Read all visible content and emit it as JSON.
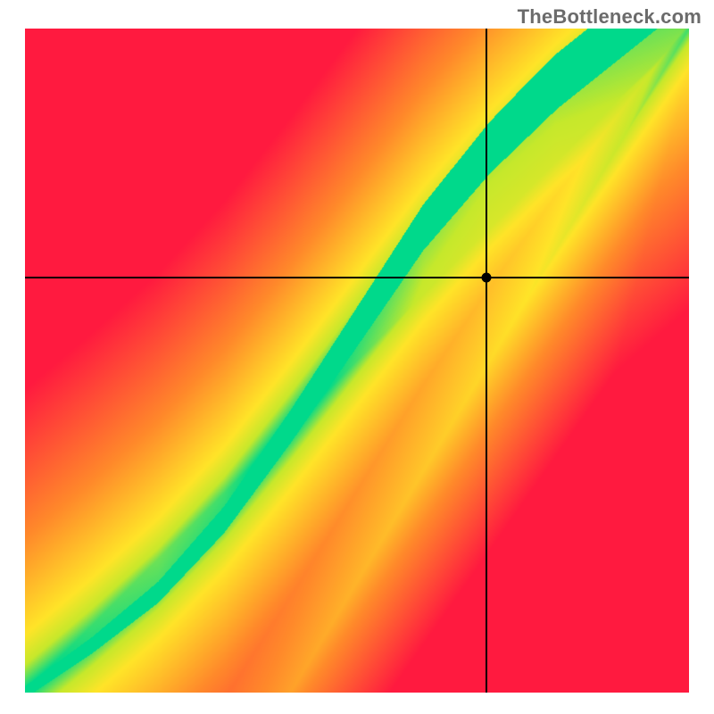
{
  "watermark": "TheBottleneck.com",
  "chart_data": {
    "type": "heatmap",
    "title": "",
    "xlabel": "",
    "ylabel": "",
    "xlim": [
      0,
      1
    ],
    "ylim": [
      0,
      1
    ],
    "crosshair": {
      "x": 0.695,
      "y": 0.625
    },
    "marker": {
      "x": 0.695,
      "y": 0.625
    },
    "gradient_description": "Heatmap with a green optimal band running diagonally from bottom-left to top-right along a slightly curved path (slope >1 overall). Red opposing corners blending through orange and yellow toward the green band.",
    "green_band_curve": [
      {
        "x": 0.0,
        "y": 0.0
      },
      {
        "x": 0.1,
        "y": 0.07
      },
      {
        "x": 0.2,
        "y": 0.15
      },
      {
        "x": 0.3,
        "y": 0.26
      },
      {
        "x": 0.4,
        "y": 0.4
      },
      {
        "x": 0.5,
        "y": 0.55
      },
      {
        "x": 0.6,
        "y": 0.7
      },
      {
        "x": 0.7,
        "y": 0.82
      },
      {
        "x": 0.8,
        "y": 0.92
      },
      {
        "x": 0.9,
        "y": 1.0
      }
    ],
    "secondary_yellow_band": [
      {
        "x": 0.4,
        "y": 0.0
      },
      {
        "x": 0.55,
        "y": 0.25
      },
      {
        "x": 0.7,
        "y": 0.5
      },
      {
        "x": 0.85,
        "y": 0.75
      },
      {
        "x": 1.0,
        "y": 1.0
      }
    ],
    "colors": {
      "red": "#ff1a3f",
      "orange": "#ff8a2a",
      "yellow": "#ffe428",
      "yellowgreen": "#c6e82b",
      "green": "#00d98b"
    }
  }
}
